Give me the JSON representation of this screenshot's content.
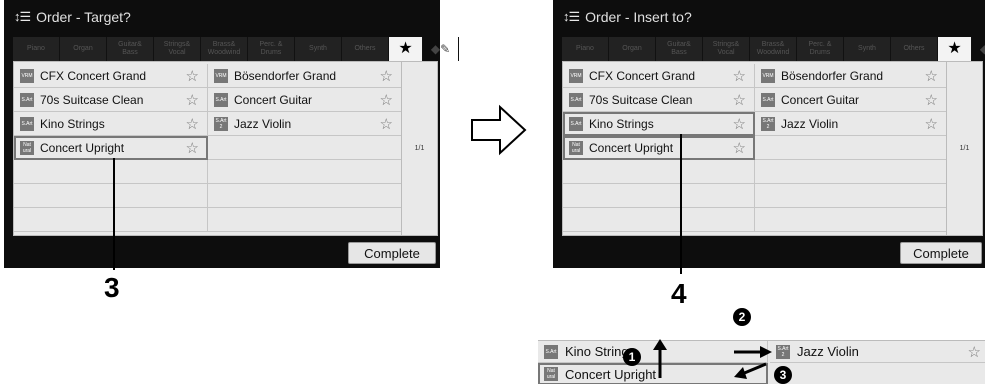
{
  "left_screen": {
    "title": "Order - Target?",
    "callout": "3"
  },
  "right_screen": {
    "title": "Order - Insert to?",
    "callout": "4"
  },
  "tabs": [
    {
      "label": "Piano"
    },
    {
      "label": "Organ"
    },
    {
      "label": "Guitar&\nBass"
    },
    {
      "label": "Strings&\nVocal"
    },
    {
      "label": "Brass&\nWoodwind"
    },
    {
      "label": "Perc. &\nDrums"
    },
    {
      "label": "Synth"
    },
    {
      "label": "Others"
    }
  ],
  "star_tab": "★",
  "voices_left": [
    {
      "badge": "VRM",
      "name": "CFX Concert Grand"
    },
    {
      "badge": "VRM",
      "name": "Bösendorfer Grand"
    },
    {
      "badge": "S.Art",
      "name": "70s Suitcase Clean"
    },
    {
      "badge": "S.Art",
      "name": "Concert Guitar"
    },
    {
      "badge": "S.Art",
      "name": "Kino Strings"
    },
    {
      "badge": "S.Art 2",
      "name": "Jazz Violin"
    },
    {
      "badge": "Nat ural",
      "name": "Concert Upright"
    }
  ],
  "page_indicator": "1/1",
  "complete_label": "Complete",
  "complete_label_right": "Complete",
  "zoom": {
    "left_top": {
      "badge": "S.Art",
      "name": "Kino Strings"
    },
    "right_top": {
      "badge": "S.Art 2",
      "name": "Jazz Violin"
    },
    "left_bottom": {
      "badge": "Nat ural",
      "name": "Concert Upright"
    },
    "steps": [
      "1",
      "2",
      "3"
    ]
  },
  "colors": {
    "screen_bg": "#0d0d0d",
    "panel_bg": "#e9e9e9",
    "highlight": "#777777"
  }
}
